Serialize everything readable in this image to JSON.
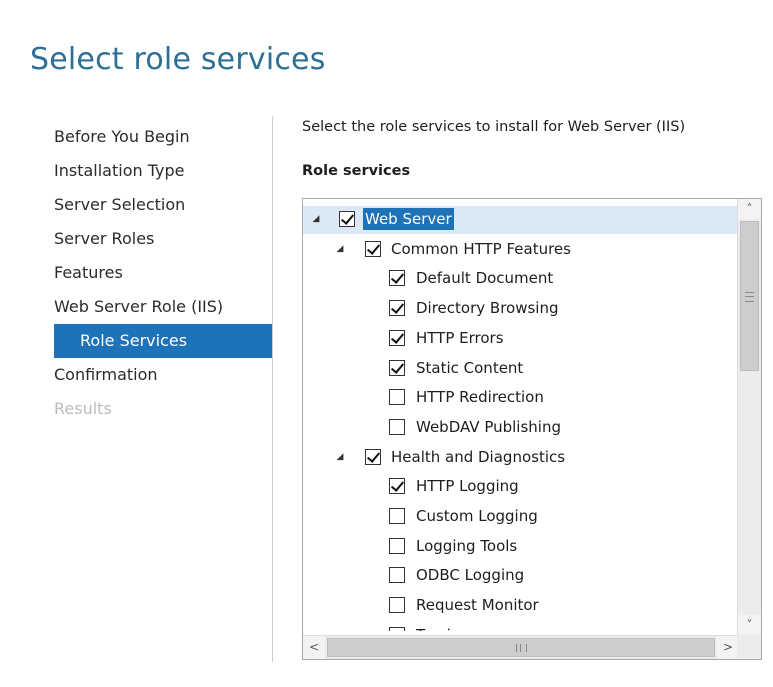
{
  "page": {
    "title": "Select role services",
    "description": "Select the role services to install for Web Server (IIS)",
    "section_label": "Role services"
  },
  "nav": {
    "items": [
      {
        "label": "Before You Begin",
        "state": "normal"
      },
      {
        "label": "Installation Type",
        "state": "normal"
      },
      {
        "label": "Server Selection",
        "state": "normal"
      },
      {
        "label": "Server Roles",
        "state": "normal"
      },
      {
        "label": "Features",
        "state": "normal"
      },
      {
        "label": "Web Server Role (IIS)",
        "state": "normal"
      },
      {
        "label": "Role Services",
        "state": "selected",
        "sub": true
      },
      {
        "label": "Confirmation",
        "state": "normal"
      },
      {
        "label": "Results",
        "state": "disabled"
      }
    ]
  },
  "tree": {
    "items": [
      {
        "label": "Web Server",
        "level": 0,
        "expanded": true,
        "checked": true,
        "selected": true
      },
      {
        "label": "Common HTTP Features",
        "level": 1,
        "expanded": true,
        "checked": true
      },
      {
        "label": "Default Document",
        "level": 2,
        "checked": true
      },
      {
        "label": "Directory Browsing",
        "level": 2,
        "checked": true
      },
      {
        "label": "HTTP Errors",
        "level": 2,
        "checked": true
      },
      {
        "label": "Static Content",
        "level": 2,
        "checked": true
      },
      {
        "label": "HTTP Redirection",
        "level": 2,
        "checked": false
      },
      {
        "label": "WebDAV Publishing",
        "level": 2,
        "checked": false
      },
      {
        "label": "Health and Diagnostics",
        "level": 1,
        "expanded": true,
        "checked": true
      },
      {
        "label": "HTTP Logging",
        "level": 2,
        "checked": true
      },
      {
        "label": "Custom Logging",
        "level": 2,
        "checked": false
      },
      {
        "label": "Logging Tools",
        "level": 2,
        "checked": false
      },
      {
        "label": "ODBC Logging",
        "level": 2,
        "checked": false
      },
      {
        "label": "Request Monitor",
        "level": 2,
        "checked": false
      },
      {
        "label": "Tracing",
        "level": 2,
        "checked": false
      }
    ]
  },
  "icons": {
    "expanded": "◢",
    "scroll_up": "˄",
    "scroll_down": "˅",
    "scroll_left": "<",
    "scroll_right": ">"
  }
}
